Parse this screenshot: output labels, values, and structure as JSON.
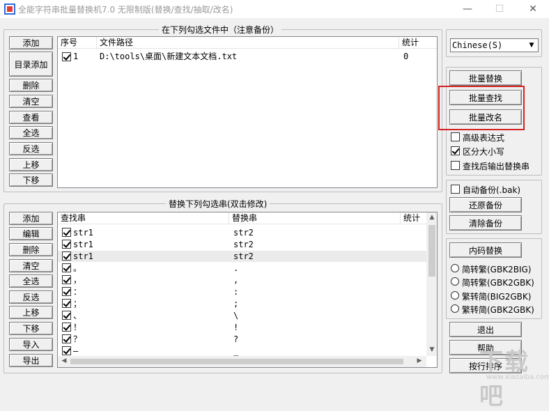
{
  "window": {
    "title": "全能字符串批量替换机7.0 无限制版(替换/查找/抽取/改名)",
    "minimize": "—",
    "maximize": "☐",
    "close": "✕"
  },
  "files_group": {
    "title": "在下列勾选文件中（注意备份）",
    "buttons": [
      "添加",
      "目录添加",
      "删除",
      "清空",
      "查看",
      "全选",
      "反选",
      "上移",
      "下移"
    ],
    "columns": [
      "序号",
      "文件路径",
      "统计"
    ],
    "rows": [
      {
        "index": "1",
        "path": "D:\\tools\\桌面\\新建文本文档.txt",
        "count": "0",
        "checked": true
      }
    ]
  },
  "replace_group": {
    "title": "替换下列勾选串(双击修改)",
    "buttons": [
      "添加",
      "编辑",
      "删除",
      "清空",
      "全选",
      "反选",
      "上移",
      "下移",
      "导入",
      "导出"
    ],
    "columns": [
      "查找串",
      "替换串",
      "统计"
    ],
    "rows": [
      {
        "find": "str1",
        "replace": "str2",
        "checked": true
      },
      {
        "find": "str1",
        "replace": "str2",
        "checked": true
      },
      {
        "find": "str1",
        "replace": "str2",
        "checked": true,
        "selected": true
      },
      {
        "find": "。",
        "replace": ".",
        "checked": true
      },
      {
        "find": "，",
        "replace": ",",
        "checked": true
      },
      {
        "find": "：",
        "replace": ":",
        "checked": true
      },
      {
        "find": "；",
        "replace": ";",
        "checked": true
      },
      {
        "find": "、",
        "replace": "\\",
        "checked": true
      },
      {
        "find": "！",
        "replace": "!",
        "checked": true
      },
      {
        "find": "？",
        "replace": "?",
        "checked": true
      },
      {
        "find": "—",
        "replace": "_",
        "checked": true
      }
    ]
  },
  "language_select": {
    "value": "Chinese(S)"
  },
  "actions": {
    "batch_replace": "批量替换",
    "batch_find": "批量查找",
    "batch_rename": "批量改名"
  },
  "options": {
    "regex": {
      "label": "高级表达式",
      "checked": false
    },
    "case_sensitive": {
      "label": "区分大小写",
      "checked": true
    },
    "output_after_find": {
      "label": "查找后输出替换串",
      "checked": false
    }
  },
  "backup": {
    "auto_backup": {
      "label": "自动备份(.bak)",
      "checked": false
    },
    "restore": "还原备份",
    "clear": "清除备份"
  },
  "encoding": {
    "inner_code_replace": "内码替换",
    "options": [
      "简转繁(GBK2BIG)",
      "简转繁(GBK2GBK)",
      "繁转简(BIG2GBK)",
      "繁转简(GBK2GBK)"
    ]
  },
  "bottom_buttons": {
    "exit": "退出",
    "help": "帮助",
    "sort_lines": "按行排序"
  },
  "watermark": {
    "text": "下载吧",
    "url": "www.xiazaiba.com"
  },
  "colors": {
    "highlight": "#d42020",
    "title_text": "#9a9a9a"
  }
}
